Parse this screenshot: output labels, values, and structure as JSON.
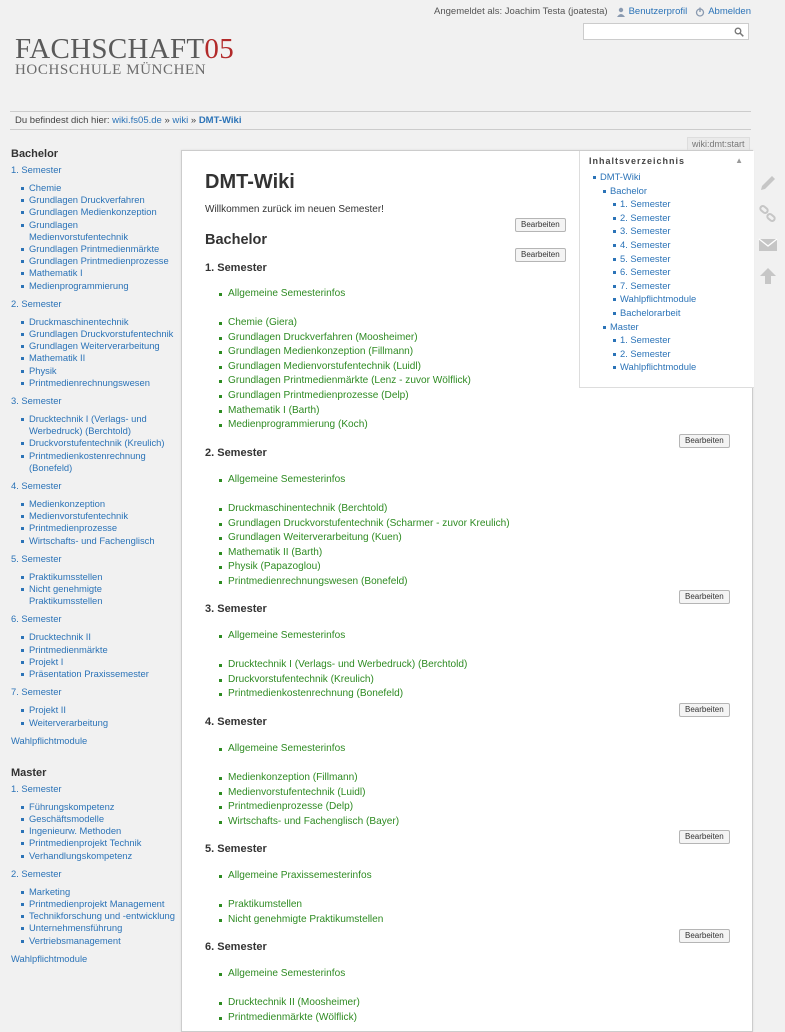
{
  "userbar": {
    "logged_in": "Angemeldet als: Joachim Testa (joatesta)",
    "profile": "Benutzerprofil",
    "logout": "Abmelden"
  },
  "logo": {
    "line1": "FACHSCHAFT",
    "number": "05",
    "line2": "HOCHSCHULE MÜNCHEN"
  },
  "breadcrumb": {
    "prefix": "Du befindest dich hier:",
    "item1": "wiki.fs05.de",
    "item2": "wiki",
    "sep": "»",
    "current": "DMT-Wiki"
  },
  "page_tag": "wiki:dmt:start",
  "sidebar": {
    "bachelor_heading": "Bachelor",
    "bachelor": [
      {
        "label": "1. Semester",
        "items": [
          "Chemie",
          "Grundlagen Druckverfahren",
          "Grundlagen Medienkonzeption",
          "Grundlagen Medienvorstufentechnik",
          "Grundlagen Printmedienmärkte",
          "Grundlagen Printmedienprozesse",
          "Mathematik I",
          "Medienprogrammierung"
        ]
      },
      {
        "label": "2. Semester",
        "items": [
          "Druckmaschinentechnik",
          "Grundlagen Druckvorstufentechnik",
          "Grundlagen Weiterverarbeitung",
          "Mathematik II",
          "Physik",
          "Printmedienrechnungswesen"
        ]
      },
      {
        "label": "3. Semester",
        "items": [
          "Drucktechnik I (Verlags- und Werbedruck) (Berchtold)",
          "Druckvorstufentechnik (Kreulich)",
          "Printmedienkostenrechnung (Bonefeld)"
        ]
      },
      {
        "label": "4. Semester",
        "items": [
          "Medienkonzeption",
          "Medienvorstufentechnik",
          "Printmedienprozesse",
          "Wirtschafts- und Fachenglisch"
        ]
      },
      {
        "label": "5. Semester",
        "items": [
          "Praktikumsstellen",
          "Nicht genehmigte Praktikumsstellen"
        ]
      },
      {
        "label": "6. Semester",
        "items": [
          "Drucktechnik II",
          "Printmedienmärkte",
          "Projekt I",
          "Präsentation Praxissemester"
        ]
      },
      {
        "label": "7. Semester",
        "items": [
          "Projekt II",
          "Weiterverarbeitung"
        ]
      }
    ],
    "bachelor_wahl": "Wahlpflichtmodule",
    "master_heading": "Master",
    "master": [
      {
        "label": "1. Semester",
        "items": [
          "Führungskompetenz",
          "Geschäftsmodelle",
          "Ingenieurw. Methoden",
          "Printmedienprojekt Technik",
          "Verhandlungskompetenz"
        ]
      },
      {
        "label": "2. Semester",
        "items": [
          "Marketing",
          "Printmedienprojekt Management",
          "Technikforschung und -entwicklung",
          "Unternehmensführung",
          "Vertriebsmanagement"
        ]
      }
    ],
    "master_wahl": "Wahlpflichtmodule"
  },
  "toc": {
    "heading": "Inhaltsverzeichnis",
    "root": "DMT-Wiki",
    "bachelor": "Bachelor",
    "bachelor_items": [
      "1. Semester",
      "2. Semester",
      "3. Semester",
      "4. Semester",
      "5. Semester",
      "6. Semester",
      "7. Semester",
      "Wahlpflichtmodule",
      "Bachelorarbeit"
    ],
    "master": "Master",
    "master_items": [
      "1. Semester",
      "2. Semester",
      "Wahlpflichtmodule"
    ]
  },
  "content": {
    "title": "DMT-Wiki",
    "intro": "Willkommen zurück im neuen Semester!",
    "edit_label": "Bearbeiten",
    "bachelor_heading": "Bachelor",
    "sections": [
      {
        "heading": "1. Semester",
        "info": "Allgemeine Semesterinfos",
        "items": [
          "Chemie (Giera)",
          "Grundlagen Druckverfahren (Moosheimer)",
          "Grundlagen Medienkonzeption (Fillmann)",
          "Grundlagen Medienvorstufentechnik (Luidl)",
          "Grundlagen Printmedienmärkte (Lenz - zuvor Wölflick)",
          "Grundlagen Printmedienprozesse (Delp)",
          "Mathematik I (Barth)",
          "Medienprogrammierung (Koch)"
        ]
      },
      {
        "heading": "2. Semester",
        "info": "Allgemeine Semesterinfos",
        "items": [
          "Druckmaschinentechnik (Berchtold)",
          "Grundlagen Druckvorstufentechnik (Scharmer - zuvor Kreulich)",
          "Grundlagen Weiterverarbeitung (Kuen)",
          "Mathematik II (Barth)",
          "Physik (Papazoglou)",
          "Printmedienrechnungswesen (Bonefeld)"
        ]
      },
      {
        "heading": "3. Semester",
        "info": "Allgemeine Semesterinfos",
        "items": [
          "Drucktechnik I (Verlags- und Werbedruck) (Berchtold)",
          "Druckvorstufentechnik (Kreulich)",
          "Printmedienkostenrechnung (Bonefeld)"
        ]
      },
      {
        "heading": "4. Semester",
        "info": "Allgemeine Semesterinfos",
        "items": [
          "Medienkonzeption (Fillmann)",
          "Medienvorstufentechnik (Luidl)",
          "Printmedienprozesse (Delp)",
          "Wirtschafts- und Fachenglisch (Bayer)"
        ]
      },
      {
        "heading": "5. Semester",
        "info": "Allgemeine Praxissemesterinfos",
        "items": [
          "Praktikumstellen",
          "Nicht genehmigte Praktikumstellen"
        ]
      },
      {
        "heading": "6. Semester",
        "info": "Allgemeine Semesterinfos",
        "items": [
          "Drucktechnik II (Moosheimer)",
          "Printmedienmärkte (Wölflick)"
        ]
      }
    ]
  },
  "tools": [
    "edit-pencil-icon",
    "backlinks-icon",
    "subscribe-mail-icon",
    "back-to-top-icon"
  ]
}
